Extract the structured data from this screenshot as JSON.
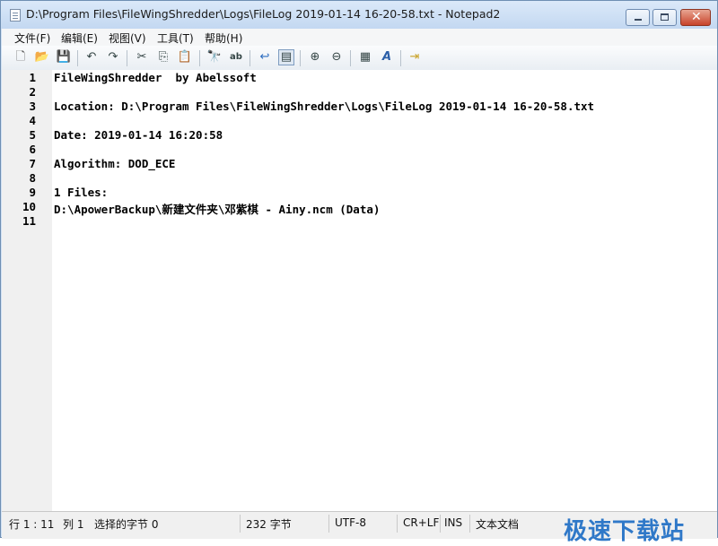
{
  "window": {
    "title": "D:\\Program Files\\FileWingShredder\\Logs\\FileLog 2019-01-14 16-20-58.txt - Notepad2"
  },
  "menu": [
    {
      "label": "文件(F)"
    },
    {
      "label": "编辑(E)"
    },
    {
      "label": "视图(V)"
    },
    {
      "label": "工具(T)"
    },
    {
      "label": "帮助(H)"
    }
  ],
  "toolbar": [
    {
      "name": "new-file-icon",
      "glyph": "🗋"
    },
    {
      "name": "open-folder-icon",
      "glyph": "📂"
    },
    {
      "name": "save-icon",
      "glyph": "💾"
    },
    {
      "name": "undo-icon",
      "glyph": "↶"
    },
    {
      "name": "redo-icon",
      "glyph": "↷"
    },
    {
      "name": "cut-icon",
      "glyph": "✂"
    },
    {
      "name": "copy-icon",
      "glyph": "⎘"
    },
    {
      "name": "paste-icon",
      "glyph": "📋"
    },
    {
      "name": "find-icon",
      "glyph": "🔭"
    },
    {
      "name": "replace-icon",
      "glyph": "ab"
    },
    {
      "name": "word-wrap-icon",
      "glyph": "↩"
    },
    {
      "name": "view-options-icon",
      "glyph": "▤"
    },
    {
      "name": "zoom-in-icon",
      "glyph": "⊕"
    },
    {
      "name": "zoom-out-icon",
      "glyph": "⊖"
    },
    {
      "name": "settings-icon",
      "glyph": "▦"
    },
    {
      "name": "font-icon",
      "glyph": "A"
    },
    {
      "name": "exit-icon",
      "glyph": "⇥"
    }
  ],
  "editor": {
    "lines": [
      {
        "num": "1",
        "text": "FileWingShredder  by Abelssoft"
      },
      {
        "num": "2",
        "text": ""
      },
      {
        "num": "3",
        "text": "Location: D:\\Program Files\\FileWingShredder\\Logs\\FileLog 2019-01-14 16-20-58.txt"
      },
      {
        "num": "4",
        "text": ""
      },
      {
        "num": "5",
        "text": "Date: 2019-01-14 16:20:58"
      },
      {
        "num": "6",
        "text": ""
      },
      {
        "num": "7",
        "text": "Algorithm: DOD_ECE"
      },
      {
        "num": "8",
        "text": ""
      },
      {
        "num": "9",
        "text": "1 Files:"
      },
      {
        "num": "10",
        "text": "D:\\ApowerBackup\\新建文件夹\\邓紫棋 - Ainy.ncm (Data)"
      },
      {
        "num": "11",
        "text": ""
      }
    ]
  },
  "status": {
    "position": "行 1 : 11",
    "column": "列 1",
    "selection": "选择的字节 0",
    "size": "232 字节",
    "encoding": "UTF-8",
    "eol": "CR+LF",
    "mode": "INS",
    "doctype": "文本文档"
  },
  "watermark": {
    "text": "极速下载站",
    "color": "#2f78c8"
  }
}
